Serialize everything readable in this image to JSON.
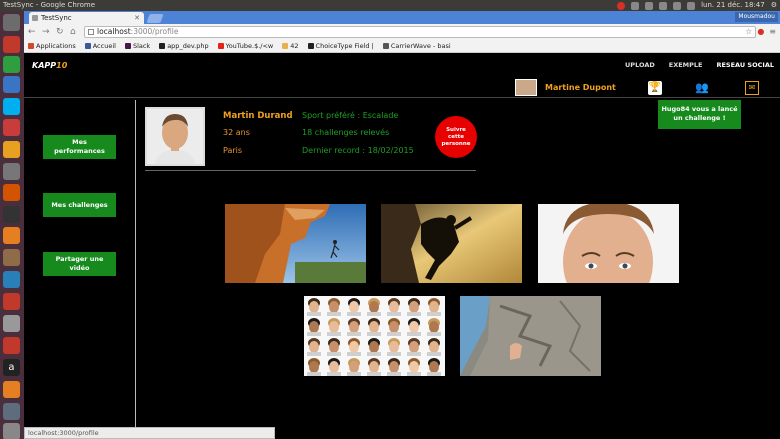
{
  "os_panel": {
    "window_title": "TestSync - Google Chrome",
    "clock": "lun. 21 déc.   18:47"
  },
  "browser": {
    "tab_title": "TestSync",
    "user_tag": "Mousmadou",
    "url_host": "localhost",
    "url_path": ":3000/profile",
    "bookmarks": [
      {
        "label": "Applications",
        "color": "#d04a2a"
      },
      {
        "label": "Accueil",
        "color": "#3b5998"
      },
      {
        "label": "Slack",
        "color": "#4a154b"
      },
      {
        "label": "app_dev.php",
        "color": "#222222"
      },
      {
        "label": "YouTube.$./<w",
        "color": "#e62117"
      },
      {
        "label": "42",
        "color": "#e8b04a"
      },
      {
        "label": "ChoiceType Field |",
        "color": "#222222"
      },
      {
        "label": "CarrierWave - basi",
        "color": "#555555"
      }
    ],
    "status_url": "localhost:3000/profile"
  },
  "site": {
    "logo_text": "KAPP",
    "logo_num": "10",
    "nav": [
      "UPLOAD",
      "EXEMPLE",
      "RESEAU SOCIAL"
    ],
    "current_user": "Martine Dupont",
    "notification": "Hugo84 vous a lancé un challenge !",
    "sidebar": [
      "Mes performances",
      "Mes challenges",
      "Partager une vidéo"
    ]
  },
  "profile": {
    "name": "Martin Durand",
    "age": "32 ans",
    "city": "Paris",
    "sport": "Sport préféré : Escalade",
    "challenges": "18 challenges relevés",
    "record": "Dernier record : 18/02/2015",
    "follow_label": "Suivre cette personne"
  },
  "icons": {
    "trophy": "trophy-icon",
    "people": "people-icon",
    "mail": "mail-icon"
  }
}
